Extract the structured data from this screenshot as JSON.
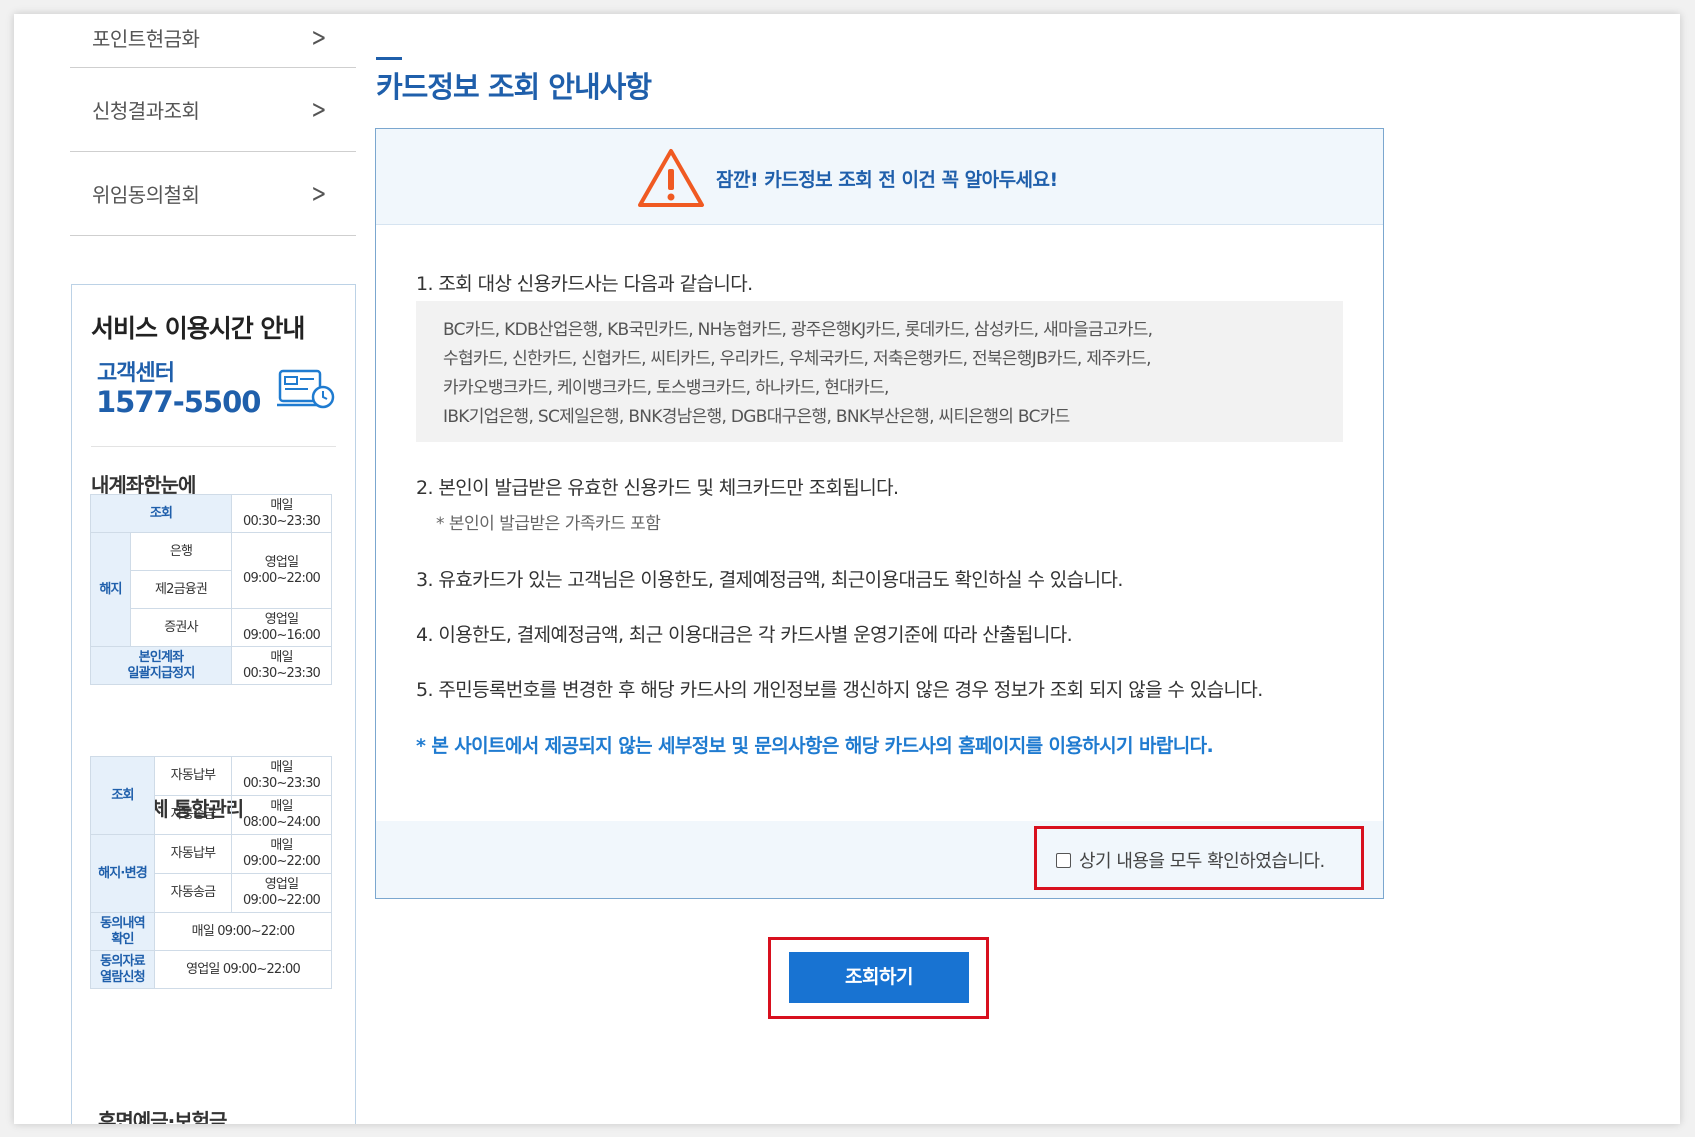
{
  "sidebar": {
    "menu": [
      {
        "label": "포인트현금화"
      },
      {
        "label": "신청결과조회"
      },
      {
        "label": "위임동의철회"
      }
    ],
    "service": {
      "title": "서비스 이용시간 안내",
      "center_label": "고객센터",
      "center_phone": "1577-5500",
      "section1": {
        "title": "내계좌한눈에",
        "rows": {
          "inquiry": {
            "label": "조회",
            "time": "매일\n00:30~23:30"
          },
          "cancel": {
            "label": "해지"
          },
          "bank": {
            "label": "은행"
          },
          "second": {
            "label": "제2금융권",
            "time": "영업일\n09:00~22:00"
          },
          "securities": {
            "label": "증권사",
            "time": "영업일\n09:00~16:00"
          },
          "stop": {
            "label": "본인계좌\n일괄지급정지",
            "time": "매일\n00:30~23:30"
          }
        }
      },
      "section2": {
        "title": "자동이체 통합관리",
        "rows": {
          "inquiry": {
            "label": "조회"
          },
          "pay1": {
            "label": "자동납부",
            "time": "매일\n00:30~23:30"
          },
          "send1": {
            "label": "자동송금",
            "time": "매일\n08:00~24:00"
          },
          "change": {
            "label": "해지·변경"
          },
          "pay2": {
            "label": "자동납부",
            "time": "매일\n09:00~22:00"
          },
          "send2": {
            "label": "자동송금",
            "time": "영업일\n09:00~22:00"
          },
          "consent": {
            "label": "동의내역\n확인",
            "time": "매일 09:00~22:00"
          },
          "docs": {
            "label": "동의자료\n열람신청",
            "time": "영업일 09:00~22:00"
          }
        }
      },
      "section3": {
        "title": "휴면예금·보험금"
      }
    }
  },
  "main": {
    "title": "카드정보 조회 안내사항",
    "warning": "잠깐! 카드정보 조회 전 이건 꼭 알아두세요!",
    "items": [
      "1. 조회 대상 신용카드사는 다음과 같습니다.",
      "2. 본인이 발급받은 유효한 신용카드 및 체크카드만 조회됩니다.",
      "3. 유효카드가 있는 고객님은 이용한도, 결제예정금액, 최근이용대금도 확인하실 수 있습니다.",
      "4. 이용한도, 결제예정금액, 최근 이용대금은 각 카드사별 운영기준에 따라 산출됩니다.",
      "5. 주민등록번호를 변경한 후 해당 카드사의 개인정보를 갱신하지 않은 경우 정보가 조회 되지 않을 수 있습니다."
    ],
    "item2_note": "* 본인이 발급받은 가족카드 포함",
    "card_lines": [
      "BC카드, KDB산업은행, KB국민카드, NH농협카드, 광주은행KJ카드, 롯데카드, 삼성카드, 새마을금고카드,",
      "수협카드, 신한카드, 신협카드, 씨티카드, 우리카드, 우체국카드, 저축은행카드, 전북은행JB카드, 제주카드,",
      "카카오뱅크카드, 케이뱅크카드, 토스뱅크카드, 하나카드, 현대카드,",
      "IBK기업은행, SC제일은행, BNK경남은행, DGB대구은행, BNK부산은행, 씨티은행의 BC카드"
    ],
    "footnote": "* 본 사이트에서 제공되지 않는 세부정보 및 문의사항은 해당 카드사의 홈페이지를 이용하시기 바랍니다.",
    "agree_label": "상기 내용을 모두 확인하였습니다.",
    "agree_checked": false,
    "submit_label": "조회하기"
  },
  "colors": {
    "accent": "#1f5fab",
    "button": "#1873d2",
    "highlight": "#d8101e",
    "warning": "#f05a22"
  }
}
